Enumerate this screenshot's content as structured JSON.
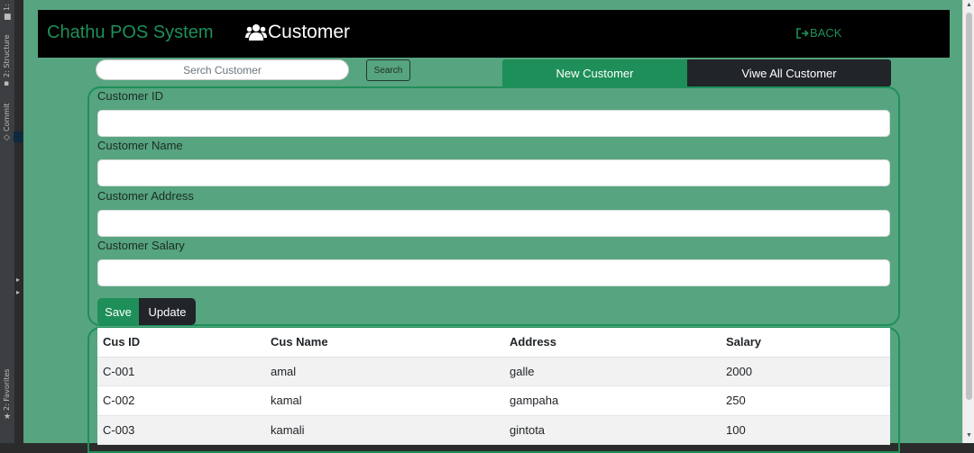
{
  "ide": {
    "tabs": [
      {
        "label": "1:",
        "icon": "folder-icon"
      },
      {
        "label": "2: Structure",
        "icon": "structure-icon"
      },
      {
        "label": "Commit",
        "icon": "commit-icon"
      },
      {
        "label": "2: Favorites",
        "icon": "star-icon"
      }
    ]
  },
  "navbar": {
    "brand": "Chathu POS System",
    "heading": "Customer",
    "heading_icon": "users-icon",
    "back_label": "BACK",
    "back_icon": "sign-out-icon"
  },
  "search": {
    "placeholder": "Serch Customer",
    "button_label": "Search"
  },
  "tabs": {
    "new_customer": "New Customer",
    "view_all": "Viwe All Customer"
  },
  "form": {
    "id_label": "Customer ID",
    "name_label": "Customer Name",
    "address_label": "Customer Address",
    "salary_label": "Customer Salary",
    "save_label": "Save",
    "update_label": "Update"
  },
  "table": {
    "headers": [
      "Cus ID",
      "Cus Name",
      "Address",
      "Salary"
    ],
    "rows": [
      [
        "C-001",
        "amal",
        "galle",
        "2000"
      ],
      [
        "C-002",
        "kamal",
        "gampaha",
        "250"
      ],
      [
        "C-003",
        "kamali",
        "gintota",
        "100"
      ]
    ]
  },
  "colors": {
    "background": "#57a480",
    "accent": "#1e8f59",
    "navbar": "#000000",
    "dark_button": "#212529"
  }
}
